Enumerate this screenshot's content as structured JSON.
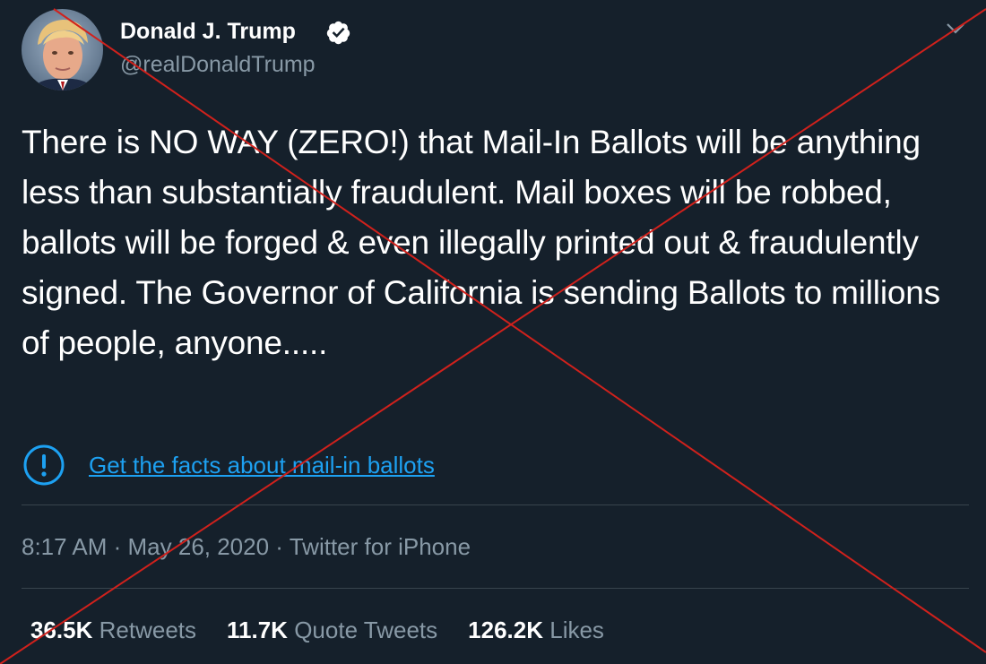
{
  "author": {
    "display_name": "Donald J. Trump",
    "handle": "@realDonaldTrump",
    "verified": true,
    "avatar_icon": "profile-photo"
  },
  "tweet": {
    "text": "There is NO WAY (ZERO!) that Mail-In Ballots will be anything less than substantially fraudulent. Mail boxes will be robbed, ballots will be forged & even illegally printed out & fraudulently signed. The Governor of California is sending Ballots to millions of people, anyone.....",
    "notice_link": "Get the facts about mail-in ballots",
    "notice_icon": "exclamation-circle-icon"
  },
  "meta": {
    "time": "8:17 AM",
    "date": "May 26, 2020",
    "source": "Twitter for iPhone",
    "separator": " · "
  },
  "stats": [
    {
      "count": "36.5K",
      "label": "Retweets"
    },
    {
      "count": "11.7K",
      "label": "Quote Tweets"
    },
    {
      "count": "126.2K",
      "label": "Likes"
    }
  ],
  "colors": {
    "background": "#15202b",
    "text": "#ffffff",
    "secondary_text": "#8899a6",
    "link": "#1da1f2",
    "divider": "#38444d",
    "cross_overlay": "#d0211c"
  }
}
